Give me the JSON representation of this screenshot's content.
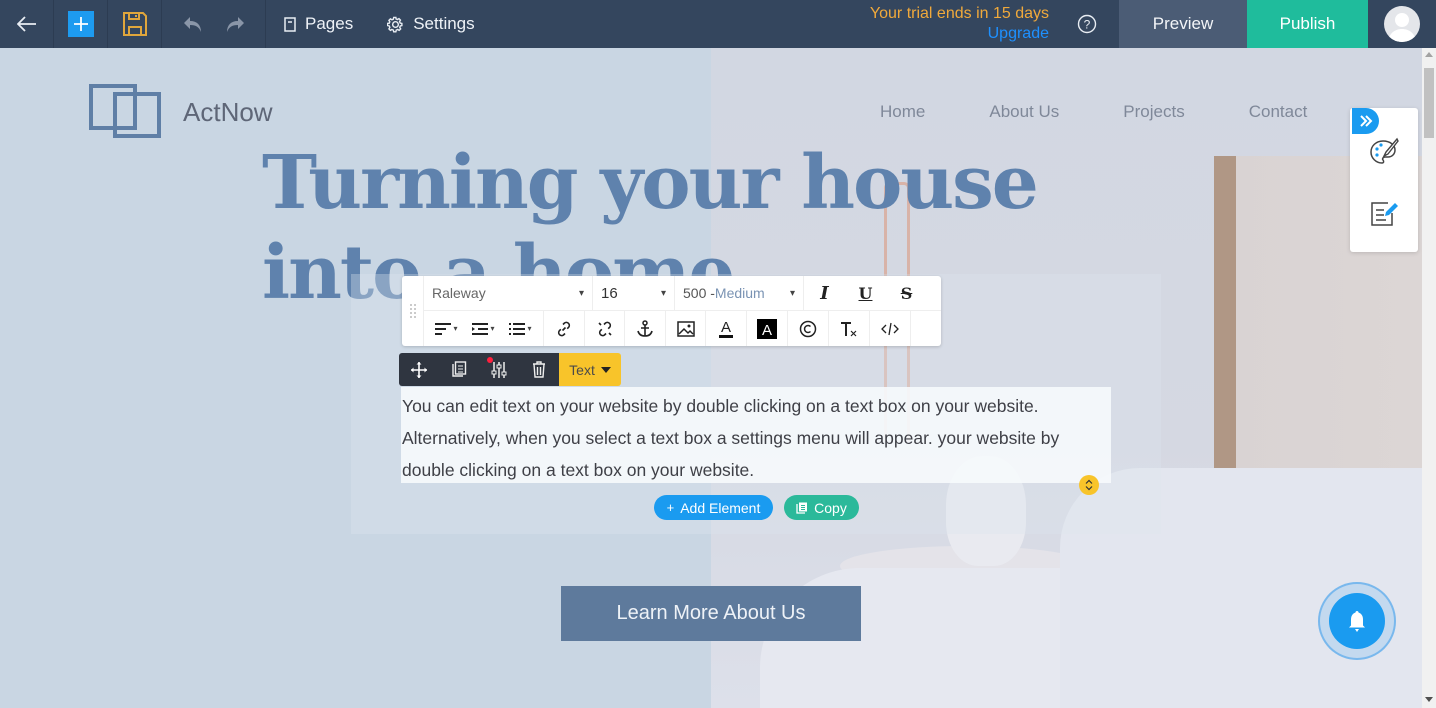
{
  "topbar": {
    "back_icon": "arrow-left-icon",
    "add_icon": "plus-icon",
    "save_icon": "floppy-disk-icon",
    "undo_icon": "undo-icon",
    "redo_icon": "redo-icon",
    "pages_label": "Pages",
    "settings_label": "Settings",
    "trial_text": "Your trial ends in 15 days",
    "upgrade_label": "Upgrade",
    "help_icon": "question-circle-icon",
    "preview_label": "Preview",
    "publish_label": "Publish",
    "colors": {
      "bar": "#34465e",
      "add": "#1d9bf0",
      "save": "#e0a63c",
      "trial": "#f0a93b",
      "upgrade": "#1e90ff",
      "preview": "#4b5c75",
      "publish": "#1fbc9c"
    }
  },
  "site": {
    "logo_text": "ActNow",
    "nav": [
      "Home",
      "About Us",
      "Projects",
      "Contact"
    ],
    "hero_line1": "Turning your house",
    "hero_line2": "into a home",
    "body_text": "You can edit text on your website by double clicking on a text box on your website. Alternatively, when you select a text box a settings menu will appear. your website by double clicking on a text box on your website.",
    "cta_label": "Learn More About Us",
    "colors": {
      "hero": "#5f82ad",
      "cta": "#5e7a9c",
      "bg": "#c9d6e3"
    }
  },
  "format_toolbar": {
    "font": "Raleway",
    "size": "16",
    "weight_num": "500 -",
    "weight_name": "Medium",
    "buttons_row1": [
      "italic-icon",
      "underline-icon",
      "strikethrough-icon"
    ],
    "buttons_row2": [
      "align-left-icon",
      "indent-icon",
      "list-icon",
      "link-icon",
      "unlink-icon",
      "anchor-icon",
      "image-icon",
      "text-color-icon",
      "highlight-icon",
      "copyright-icon",
      "clear-format-icon",
      "code-icon"
    ]
  },
  "element_toolbar": {
    "buttons": [
      "move-icon",
      "duplicate-icon",
      "settings-sliders-icon",
      "trash-icon"
    ],
    "type_label": "Text",
    "colors": {
      "dark": "#2f3540",
      "type": "#f8c42a",
      "notify_dot": "#ff1f3d"
    }
  },
  "actions": {
    "add_element_label": "Add Element",
    "copy_label": "Copy",
    "colors": {
      "add": "#1a9bf0",
      "copy": "#2bb99a"
    }
  },
  "side_panel": {
    "expand_icon": "double-chevron-right-icon",
    "items": [
      "palette-icon",
      "edit-document-icon"
    ]
  },
  "notification": {
    "icon": "bell-icon"
  }
}
